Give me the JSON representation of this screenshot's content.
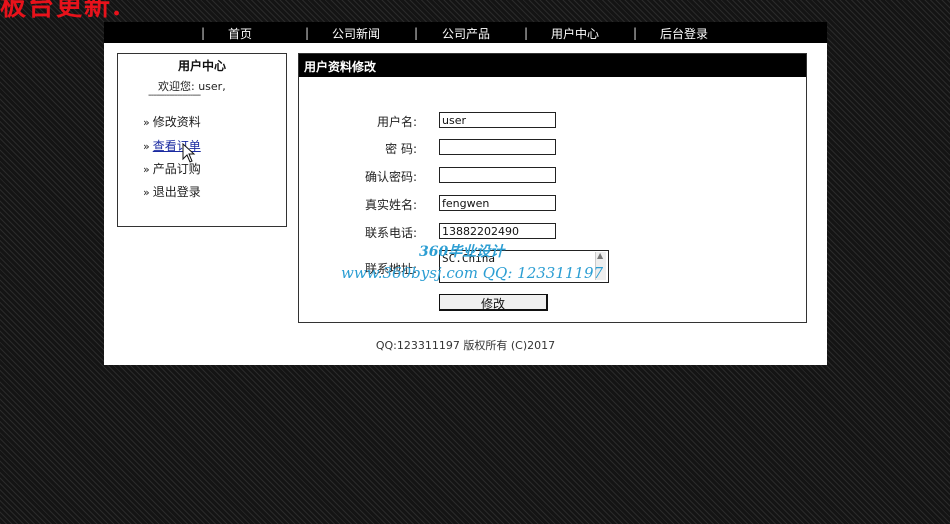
{
  "banner": {
    "text": "板台更新."
  },
  "nav": {
    "items": [
      "首页",
      "公司新闻",
      "公司产品",
      "用户中心",
      "后台登录"
    ],
    "separator": "|"
  },
  "sidebar": {
    "title": "用户中心",
    "welcome": "欢迎您:  user,",
    "divider": "--------------------",
    "chevron": "»",
    "links": [
      "修改资料",
      "查看订单",
      "产品订购",
      "退出登录"
    ]
  },
  "form": {
    "header": "用户资料修改",
    "labels": {
      "username": "用户名:",
      "password": "密  码:",
      "confirm": "确认密码:",
      "realname": "真实姓名:",
      "phone": "联系电话:",
      "address": "联系地址:"
    },
    "values": {
      "username": "user",
      "password": "",
      "confirm": "",
      "realname": "fengwen",
      "phone": "13882202490",
      "address": "SC.China"
    },
    "submit": "修改"
  },
  "watermark": {
    "line1": "360毕业设计",
    "line2": "www.360bysj.com    QQ:  123311197"
  },
  "footer": {
    "text": "QQ:123311197 版权所有  (C)2017"
  }
}
